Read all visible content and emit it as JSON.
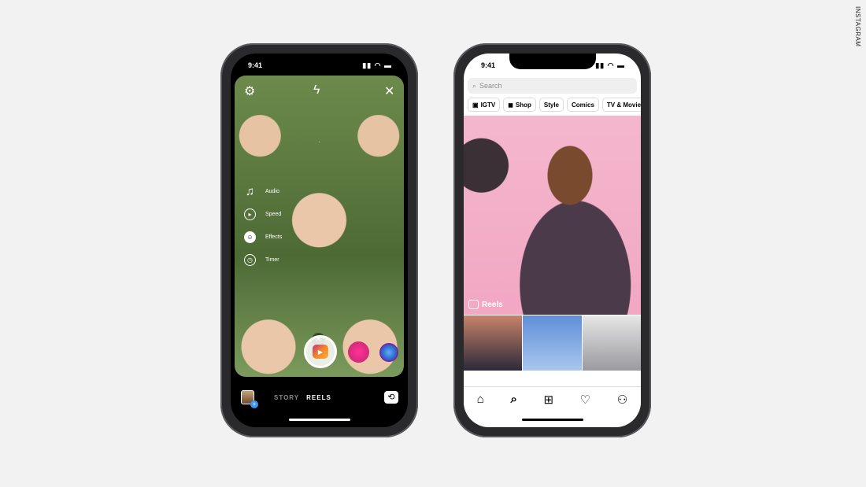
{
  "watermark": "INSTAGRAM",
  "left_phone": {
    "status_time": "9:41",
    "top_icons": [
      "settings-icon",
      "flash-auto-icon",
      "close-icon"
    ],
    "side_tools": [
      {
        "icon": "music-note-icon",
        "label": "Audio"
      },
      {
        "icon": "speed-icon",
        "label": "Speed"
      },
      {
        "icon": "smiley-icon",
        "label": "Effects"
      },
      {
        "icon": "timer-icon",
        "label": "Timer"
      }
    ],
    "modes": {
      "story": "STORY",
      "reels": "REELS"
    },
    "accent": "#c13584"
  },
  "right_phone": {
    "status_time": "9:41",
    "search_placeholder": "Search",
    "chips": [
      {
        "icon": "igtv-icon",
        "label": "IGTV"
      },
      {
        "icon": "shop-bag-icon",
        "label": "Shop"
      },
      {
        "label": "Style"
      },
      {
        "label": "Comics"
      },
      {
        "label": "TV & Movie"
      }
    ],
    "hero_label": "Reels",
    "tabs": [
      "home-icon",
      "search-icon",
      "new-post-icon",
      "heart-icon",
      "profile-icon"
    ]
  }
}
